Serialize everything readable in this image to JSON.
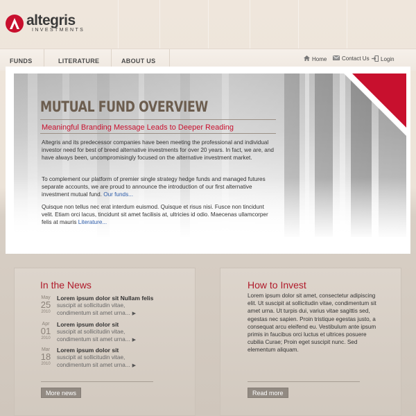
{
  "brand": {
    "name": "altegris",
    "sub": "INVESTMENTS",
    "color": "#c8102e"
  },
  "nav": {
    "items": [
      {
        "label": "FUNDS"
      },
      {
        "label": "LITERATURE"
      },
      {
        "label": "ABOUT US"
      }
    ],
    "utility": [
      {
        "label": "Home",
        "icon": "home-icon"
      },
      {
        "label": "Contact Us",
        "icon": "envelope-icon"
      },
      {
        "label": "Login",
        "icon": "login-icon"
      }
    ]
  },
  "hero": {
    "title": "MUTUAL FUND OVERVIEW",
    "subtitle": "Meaningful Branding Message Leads to Deeper Reading",
    "p1": "Altegris and its predecessor companies have been meeting the professional and individual investor need for best of breed alternative investments for over 20 years. In fact, we are, and have always been, uncompromisingly focused on the alternative investment market.",
    "p2": "To complement our platform of premier single strategy hedge funds and managed futures separate accounts, we are proud to announce the introduction of our first alternative investment mutual fund.",
    "p2_link": "Our funds...",
    "p3": "Quisque non tellus nec erat interdum euismod. Quisque et risus nisi. Fusce non tincidunt velit. Etiam orci lacus, tincidunt sit amet facilisis at, ultricies id odio. Maecenas ullamcorper felis at mauris",
    "p3_link": "Literature..."
  },
  "news": {
    "title": "In the News",
    "items": [
      {
        "month": "May",
        "day": "25",
        "year": "2010",
        "headline": "Lorem ipsum dolor sit Nullam felis",
        "line1": "suscipit at sollicitudin vitae,",
        "line2": "condimentum sit amet urna..."
      },
      {
        "month": "Apr",
        "day": "01",
        "year": "2010",
        "headline": "Lorem ipsum dolor sit",
        "line1": "suscipit at sollicitudin vitae,",
        "line2": "condimentum sit amet urna..."
      },
      {
        "month": "Mar",
        "day": "18",
        "year": "2010",
        "headline": "Lorem ipsum dolor sit",
        "line1": "suscipit at sollicitudin vitae,",
        "line2": "condimentum sit amet urna..."
      }
    ],
    "button": "More news"
  },
  "invest": {
    "title": "How to Invest",
    "body": "Lorem ipsum dolor sit amet, consectetur adipiscing elit. Ut suscipit at sollicitudin vitae, condimentum sit amet urna. Ut turpis dui, varius vitae sagittis sed, egestas nec sapien. Proin tristique egestas justo, a consequat arcu eleifend eu. Vestibulum ante ipsum primis in faucibus orci luctus et ultrices posuere cubilia Curae; Proin eget suscipit nunc. Sed elementum aliquam.",
    "button": "Read more"
  }
}
